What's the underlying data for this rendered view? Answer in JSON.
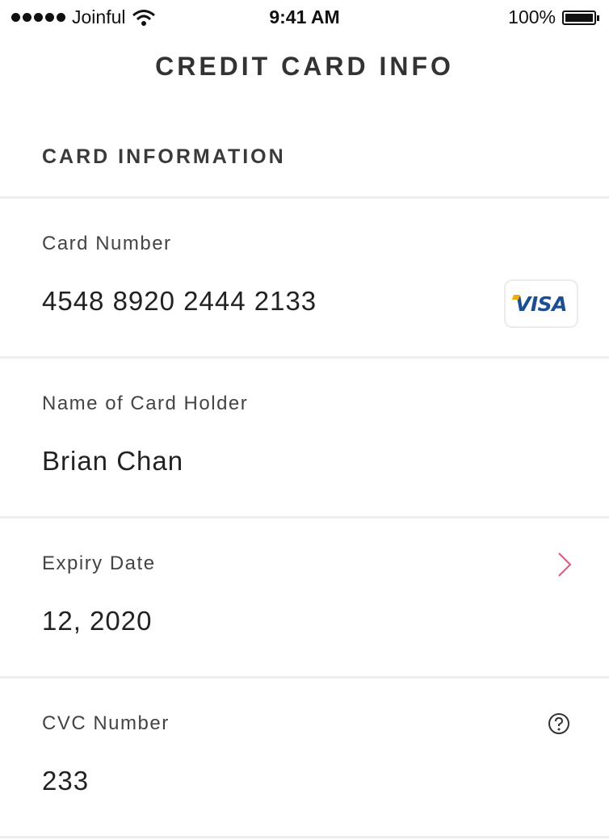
{
  "status_bar": {
    "carrier": "Joinful",
    "time": "9:41 AM",
    "battery": "100%",
    "icons": [
      "signal-dots-icon",
      "wifi-icon",
      "battery-icon"
    ]
  },
  "header": {
    "title": "CREDIT CARD INFO"
  },
  "section": {
    "title": "CARD INFORMATION"
  },
  "fields": {
    "card_number": {
      "label": "Card Number",
      "value": "4548 8920 2444 2133",
      "brand": "VISA",
      "brand_icon": "visa-logo-icon"
    },
    "card_holder": {
      "label": "Name of Card Holder",
      "value": "Brian Chan"
    },
    "expiry": {
      "label": "Expiry Date",
      "value": "12, 2020",
      "action_icon": "chevron-right-icon"
    },
    "cvc": {
      "label": "CVC Number",
      "value": "233",
      "help_icon": "help-circle-icon"
    }
  },
  "colors": {
    "accent_chevron": "#e8557a",
    "visa_blue": "#1a4f96",
    "visa_gold": "#f2a900",
    "divider": "#efefef",
    "text": "#222222"
  }
}
